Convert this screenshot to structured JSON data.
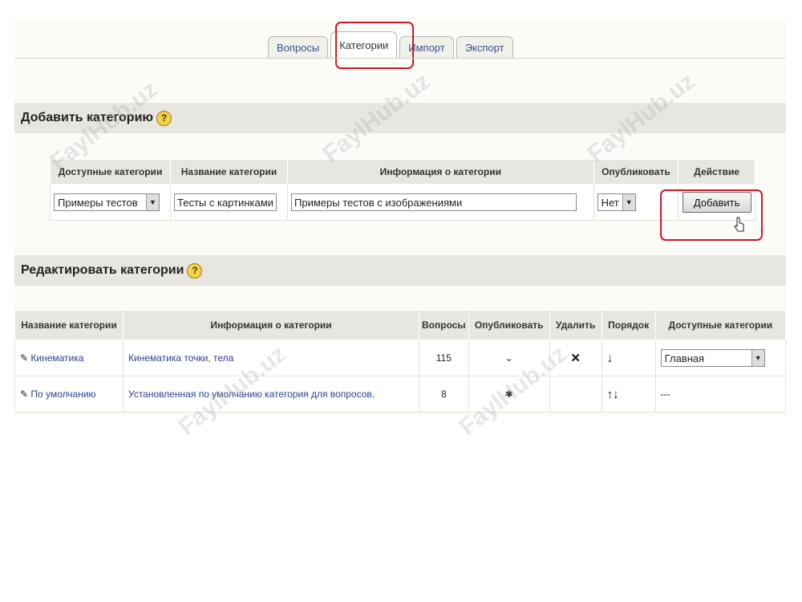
{
  "tabs": [
    {
      "label": "Вопросы"
    },
    {
      "label": "Категории"
    },
    {
      "label": "Импорт"
    },
    {
      "label": "Экспорт"
    }
  ],
  "add_section": {
    "title": "Добавить категорию",
    "help": "?",
    "headers": [
      "Доступные категории",
      "Название категории",
      "Информация о категории",
      "Опубликовать",
      "Действие"
    ],
    "parent_select": "Примеры тестов",
    "name_value": "Тесты с картинками",
    "info_value": "Примеры тестов с изображениями",
    "publish_select": "Нет",
    "add_button": "Добавить"
  },
  "edit_section": {
    "title": "Редактировать категории",
    "help": "?",
    "headers": [
      "Название категории",
      "Информация о категории",
      "Вопросы",
      "Опубликовать",
      "Удалить",
      "Порядок",
      "Доступные категории"
    ],
    "rows": [
      {
        "name": "Кинематика",
        "info": "Кинематика точки, тела",
        "questions": "115",
        "publish": "⌄",
        "delete": "✕",
        "order": "↓",
        "parent": "Главная"
      },
      {
        "name": "По умолчанию",
        "info": "Установленная по умолчанию категория для вопросов.",
        "questions": "8",
        "publish": "✱",
        "delete": "",
        "order": "↑↓",
        "parent": "---"
      }
    ]
  },
  "watermark": "FaylHub.uz"
}
